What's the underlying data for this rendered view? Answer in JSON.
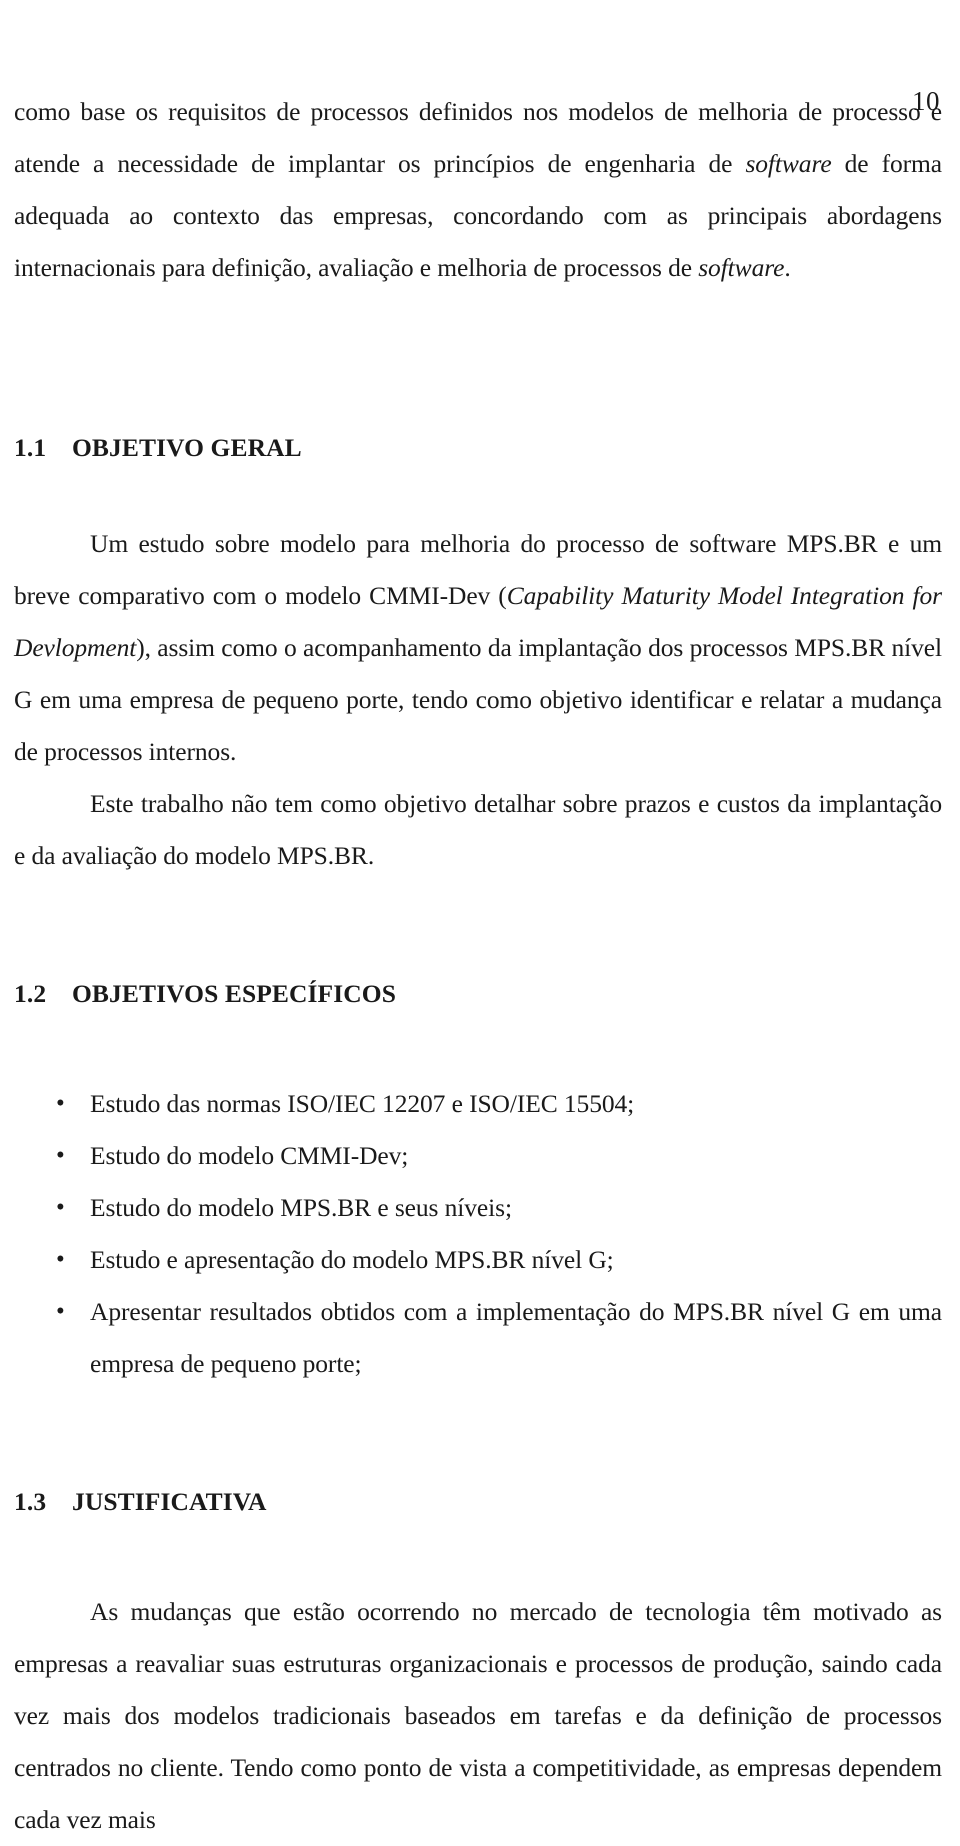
{
  "page": {
    "number": "10"
  },
  "intro": {
    "paragraph_parts": [
      "como base os requisitos de processos definidos nos modelos de melhoria de processo e atende a necessidade de implantar os princípios de engenharia de ",
      "software",
      " de forma adequada ao contexto das empresas, concordando com as principais abordagens internacionais para definição, avaliação e melhoria de processos de ",
      "software",
      "."
    ]
  },
  "sections": [
    {
      "number": "1.1",
      "title": "OBJETIVO GERAL",
      "paragraphs": [
        {
          "parts": [
            "Um estudo sobre modelo para melhoria do processo de software MPS.BR e um breve comparativo com o modelo CMMI-Dev (",
            "Capability Maturity Model Integration for Devlopment",
            "), assim como o acompanhamento da implantação dos processos MPS.BR nível G em uma empresa de pequeno porte, tendo como objetivo identificar e relatar a mudança de processos internos."
          ]
        },
        {
          "parts": [
            "Este trabalho não tem como objetivo detalhar sobre prazos e custos da implantação e da avaliação do modelo MPS.BR."
          ]
        }
      ]
    },
    {
      "number": "1.2",
      "title": "OBJETIVOS ESPECÍFICOS",
      "bullets": [
        "Estudo das normas ISO/IEC 12207 e ISO/IEC 15504;",
        "Estudo do modelo CMMI-Dev;",
        "Estudo do modelo MPS.BR e seus níveis;",
        "Estudo e apresentação do modelo MPS.BR nível G;",
        "Apresentar resultados obtidos com a implementação do MPS.BR nível G em uma empresa de pequeno porte;"
      ]
    },
    {
      "number": "1.3",
      "title": "JUSTIFICATIVA",
      "paragraphs": [
        {
          "parts": [
            "As mudanças que estão ocorrendo no mercado de tecnologia têm motivado as empresas a reavaliar suas estruturas organizacionais e processos de produção, saindo cada vez mais dos modelos tradicionais baseados em tarefas e da definição de processos centrados no cliente. Tendo como ponto de vista a competitividade, as empresas dependem cada vez mais"
          ]
        }
      ]
    }
  ]
}
